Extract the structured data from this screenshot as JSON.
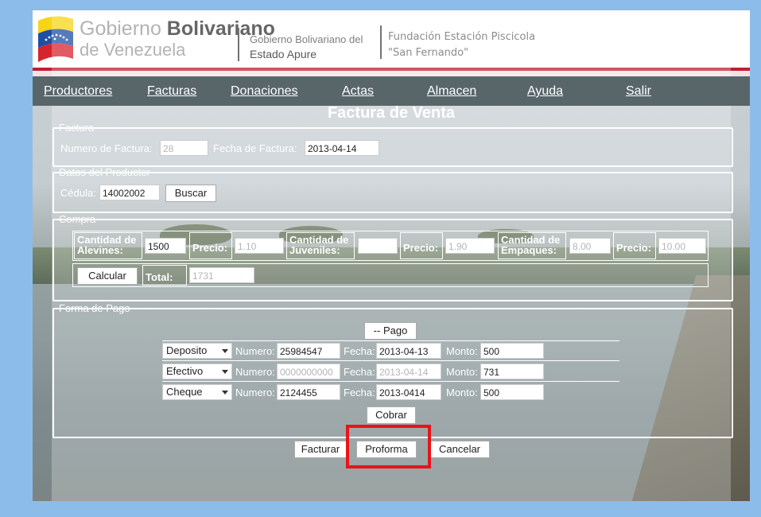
{
  "header": {
    "gb_title_plain": "Gobierno ",
    "gb_title_bold": "Bolivariano",
    "gb_subtitle": "de Venezuela",
    "apure_line1": "Gobierno Bolivariano del",
    "apure_line2": "Estado Apure",
    "fund_line1": "Fundación Estación Piscicola",
    "fund_line2": "\"San Fernando\""
  },
  "nav": {
    "items": [
      {
        "label": "Productores"
      },
      {
        "label": "Facturas"
      },
      {
        "label": "Donaciones"
      },
      {
        "label": "Actas"
      },
      {
        "label": "Almacen"
      },
      {
        "label": "Ayuda"
      },
      {
        "label": "Salir"
      }
    ]
  },
  "page_title": "Factura de Venta",
  "factura": {
    "legend": "Factura",
    "numero_label": "Numero de Factura:",
    "numero_value": "28",
    "fecha_label": "Fecha de Factura:",
    "fecha_value": "2013-04-14"
  },
  "productor": {
    "legend": "Datos del Productor",
    "cedula_label": "Cédula:",
    "cedula_value": "14002002",
    "buscar_label": "Buscar"
  },
  "compra": {
    "legend": "Compra",
    "alevines_label_1": "Cantidad de",
    "alevines_label_2": "Alevines:",
    "alevines_value": "1500",
    "precio1_label": "Precio:",
    "precio1_value": "1.10",
    "juveniles_label_1": "Cantidad de",
    "juveniles_label_2": "Juveniles:",
    "juveniles_value": "",
    "precio2_label": "Precio:",
    "precio2_value": "1.90",
    "empaques_label_1": "Cantidad de",
    "empaques_label_2": "Empaques:",
    "empaques_value": "8.00",
    "precio3_label": "Precio:",
    "precio3_value": "10.00",
    "calcular_label": "Calcular",
    "total_label": "Total:",
    "total_value": "1731"
  },
  "pago": {
    "legend": "Forma de Pago",
    "pago_button": "-- Pago",
    "numero_label": "Numero:",
    "fecha_label": "Fecha:",
    "monto_label": "Monto:",
    "rows": [
      {
        "tipo": "Deposito",
        "numero": "25984547",
        "fecha": "2013-04-13",
        "monto": "500"
      },
      {
        "tipo": "Efectivo",
        "numero": "0000000000",
        "fecha": "2013-04-14",
        "monto": "731"
      },
      {
        "tipo": "Cheque",
        "numero": "2124455",
        "fecha": "2013-0414",
        "monto": "500"
      }
    ],
    "cobrar_label": "Cobrar"
  },
  "actions": {
    "facturar": "Facturar",
    "proforma": "Proforma",
    "cancelar": "Cancelar"
  },
  "colors": {
    "nav_bg": "#58666a",
    "outer_bg": "#8cbcea",
    "highlight": "#e8141a",
    "header_red": "#c21e2e"
  }
}
